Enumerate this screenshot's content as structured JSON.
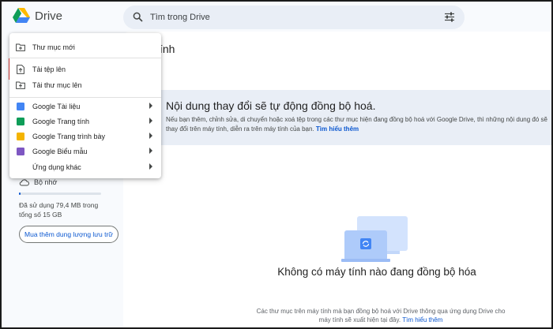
{
  "app": {
    "name": "Drive"
  },
  "search": {
    "placeholder": "Tìm trong Drive"
  },
  "main": {
    "title_fragment": "ính",
    "banner": {
      "title": "Nội dung thay đổi sẽ tự động đồng bộ hoá.",
      "description": "Nếu bạn thêm, chỉnh sửa, di chuyển hoặc xoá tệp trong các thư mục hiện đang đồng bộ hoá với Google Drive, thì những nội dung đó sẽ thay đổi trên máy tính, diễn ra trên máy tính của bạn.",
      "link": "Tìm hiểu thêm"
    },
    "empty_state": {
      "title": "Không có máy tính nào đang đồng bộ hóa",
      "description": "Các thư mục trên máy tính mà bạn đồng bộ hoá với Drive thông qua ứng dụng Drive cho máy tính sẽ xuất hiện tại đây.",
      "link": "Tìm hiểu thêm"
    }
  },
  "sidebar": {
    "storage_label": "Bộ nhớ",
    "storage_used_fraction": 0.005,
    "storage_text": "Đã sử dụng 79,4 MB trong tổng số 15 GB",
    "buy_button": "Mua thêm dung lượng lưu trữ"
  },
  "menu": {
    "new_folder": "Thư mục mới",
    "upload_file": "Tải tệp lên",
    "upload_folder": "Tải thư mục lên",
    "google_docs": "Google Tài liệu",
    "google_sheets": "Google Trang tính",
    "google_slides": "Google Trang trình bày",
    "google_forms": "Google Biểu mẫu",
    "more_apps": "Ứng dụng khác"
  },
  "colors": {
    "docs": "#4285f4",
    "sheets": "#0f9d58",
    "slides": "#f4b400",
    "forms": "#7e57c2",
    "highlight_border": "#e53935",
    "link": "#0b57d0"
  },
  "icons": {
    "logo": "google-drive-logo",
    "search": "search-icon",
    "filter": "tune-icon",
    "new_folder": "folder-plus-icon",
    "upload_file": "file-upload-icon",
    "upload_folder": "folder-upload-icon",
    "storage": "cloud-icon",
    "submenu": "chevron-right-icon"
  }
}
